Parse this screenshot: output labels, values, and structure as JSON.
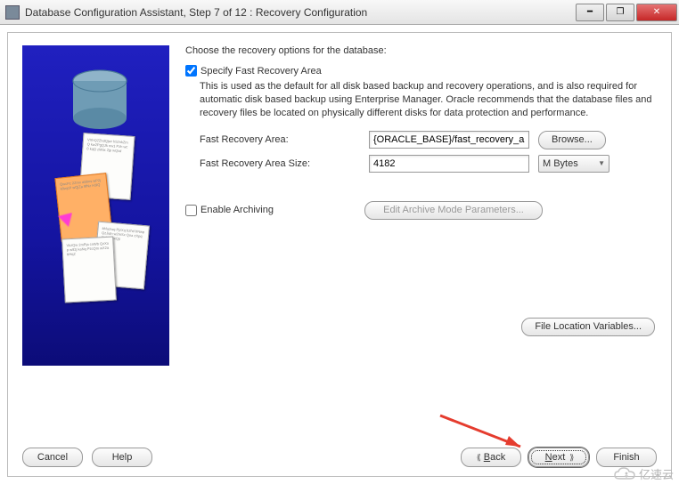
{
  "window": {
    "title": "Database Configuration Assistant, Step 7 of 12 : Recovery Configuration"
  },
  "main": {
    "instruction": "Choose the recovery options for the database:",
    "specify_fra": {
      "checked": true,
      "label": "Specify Fast Recovery Area",
      "description": "This is used as the default for all disk based backup and recovery operations, and is also required for automatic disk based backup using Enterprise Manager. Oracle recommends that the database files and recovery files be located on physically different disks for data protection and performance.",
      "area_label": "Fast Recovery Area:",
      "area_value": "{ORACLE_BASE}/fast_recovery_area",
      "browse_label": "Browse...",
      "size_label": "Fast Recovery Area Size:",
      "size_value": "4182",
      "size_unit": "M Bytes"
    },
    "archiving": {
      "checked": false,
      "label": "Enable Archiving",
      "params_button": "Edit Archive Mode Parameters..."
    },
    "file_loc_button": "File Location Variables..."
  },
  "footer": {
    "cancel": "Cancel",
    "help": "Help",
    "back": "Back",
    "back_mn": "B",
    "next": "Next",
    "next_mn": "N",
    "finish": "Finish"
  },
  "watermark": "亿速云"
}
